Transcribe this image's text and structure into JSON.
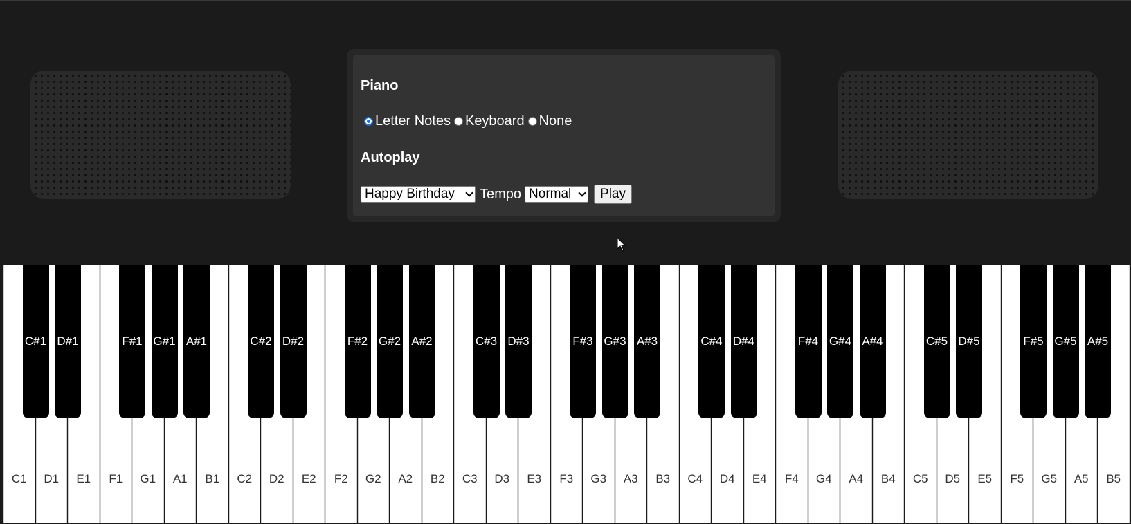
{
  "panel": {
    "piano_title": "Piano",
    "label_options": [
      {
        "label": "Letter Notes",
        "checked": true
      },
      {
        "label": "Keyboard",
        "checked": false
      },
      {
        "label": "None",
        "checked": false
      }
    ],
    "autoplay_title": "Autoplay",
    "song_selected": "Happy Birthday",
    "tempo_label": "Tempo",
    "tempo_selected": "Normal",
    "play_label": "Play"
  },
  "keyboard": {
    "white_keys": [
      "C1",
      "D1",
      "E1",
      "F1",
      "G1",
      "A1",
      "B1",
      "C2",
      "D2",
      "E2",
      "F2",
      "G2",
      "A2",
      "B2",
      "C3",
      "D3",
      "E3",
      "F3",
      "G3",
      "A3",
      "B3",
      "C4",
      "D4",
      "E4",
      "F4",
      "G4",
      "A4",
      "B4",
      "C5",
      "D5",
      "E5",
      "F5",
      "G5",
      "A5",
      "B5"
    ],
    "black_keys": [
      "C#1",
      "D#1",
      "F#1",
      "G#1",
      "A#1",
      "C#2",
      "D#2",
      "F#2",
      "G#2",
      "A#2",
      "C#3",
      "D#3",
      "F#3",
      "G#3",
      "A#3",
      "C#4",
      "D#4",
      "F#4",
      "G#4",
      "A#4",
      "C#5",
      "D#5",
      "F#5",
      "G#5",
      "A#5"
    ]
  },
  "colors": {
    "background": "#1b1b1b",
    "panel": "#333333",
    "radio_accent": "#1a73e8"
  }
}
